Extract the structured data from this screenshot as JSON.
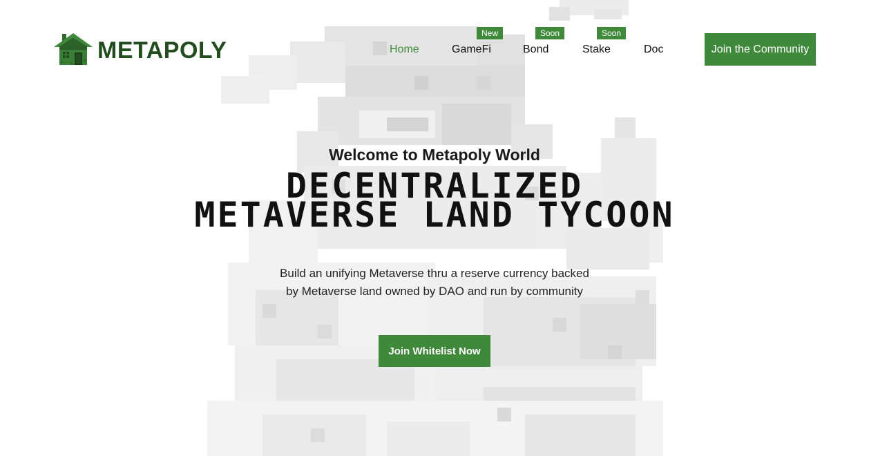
{
  "brand": {
    "name": "METAPOLY",
    "logo_icon": "pixel-house-icon",
    "color": "#214e1c"
  },
  "nav": {
    "items": [
      {
        "label": "Home",
        "active": true
      },
      {
        "label": "GameFi",
        "badge": "New"
      },
      {
        "label": "Bond",
        "badge": "Soon"
      },
      {
        "label": "Stake",
        "badge": "Soon"
      },
      {
        "label": "Doc"
      }
    ],
    "cta_label": "Join the Community"
  },
  "hero": {
    "welcome": "Welcome to Metapoly World",
    "title_lines": [
      "DECENTRALIZED",
      "METAVERSE LAND TYCOON"
    ],
    "subtitle_lines": [
      "Build an unifying Metaverse thru a reserve currency backed",
      "by Metaverse land owned by DAO and run by community"
    ],
    "cta_label": "Join Whitelist Now"
  },
  "colors": {
    "accent": "#3f8a3a",
    "text": "#111111",
    "background": "#ffffff"
  }
}
